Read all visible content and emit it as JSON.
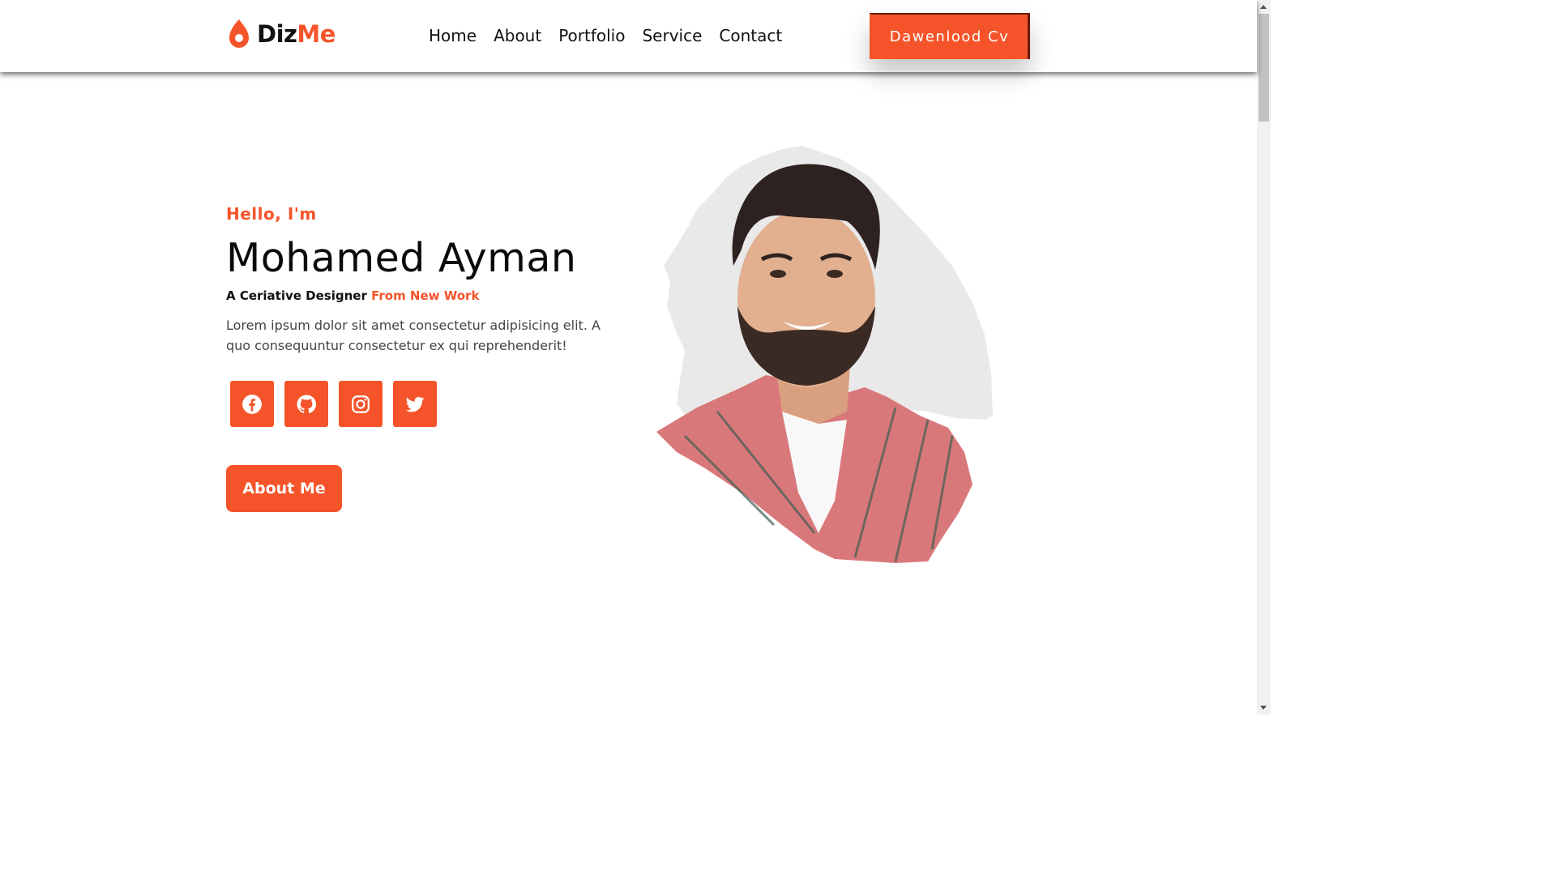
{
  "brand": {
    "name_dark": "Diz",
    "name_accent": "Me"
  },
  "nav": {
    "items": [
      "Home",
      "About",
      "Portfolio",
      "Service",
      "Contact"
    ]
  },
  "cv_button": {
    "label": "Dawenlood Cv"
  },
  "hero": {
    "greeting": "Hello, I'm",
    "name": "Mohamed Ayman",
    "role_prefix": "A Ceriative Designer",
    "role_accent": "From New Work",
    "description": "Lorem ipsum dolor sit amet consectetur adipisicing elit. A quo consequuntur consectetur ex qui reprehenderit!",
    "socials": [
      "facebook-icon",
      "github-icon",
      "instagram-icon",
      "twitter-icon"
    ],
    "about_button": "About Me"
  },
  "colors": {
    "accent": "#f5542a",
    "text_dark": "#111111",
    "text_body": "#444444"
  }
}
